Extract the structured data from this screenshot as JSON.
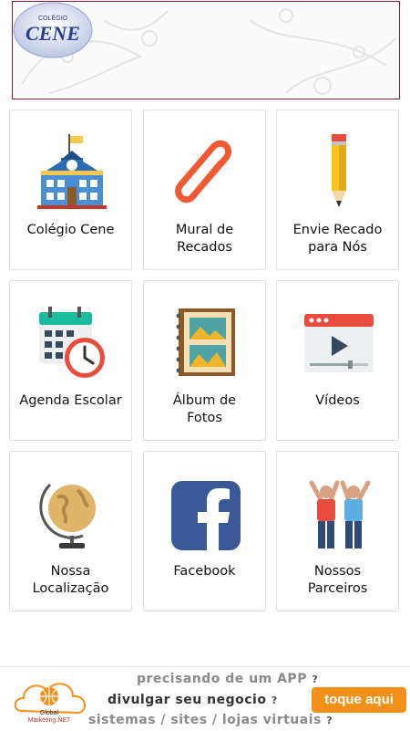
{
  "header": {
    "logo_top": "COLÉGIO",
    "logo_main": "CENE"
  },
  "tiles": [
    {
      "label": "Colégio Cene",
      "icon": "school-building-icon"
    },
    {
      "label": "Mural de\nRecados",
      "icon": "paperclip-icon"
    },
    {
      "label": "Envie Recado\npara Nós",
      "icon": "pencil-icon"
    },
    {
      "label": "Agenda Escolar",
      "icon": "calendar-clock-icon"
    },
    {
      "label": "Álbum de\nFotos",
      "icon": "photo-album-icon"
    },
    {
      "label": "Vídeos",
      "icon": "video-player-icon"
    },
    {
      "label": "Nossa\nLocalização",
      "icon": "globe-icon"
    },
    {
      "label": "Facebook",
      "icon": "facebook-icon"
    },
    {
      "label": "Nossos\nParceiros",
      "icon": "people-cheering-icon"
    }
  ],
  "ad": {
    "brand_line1": "Global",
    "brand_line2": "Marketing.NET",
    "line1": "precisando de um APP",
    "line2": "divulgar seu negocio",
    "line3": "sistemas / sites / lojas virtuais",
    "qmark": "?",
    "cta": "toque aqui"
  },
  "colors": {
    "header_border": "#8b1a2b",
    "cta_orange": "#f39018",
    "facebook_blue": "#3b5998"
  }
}
